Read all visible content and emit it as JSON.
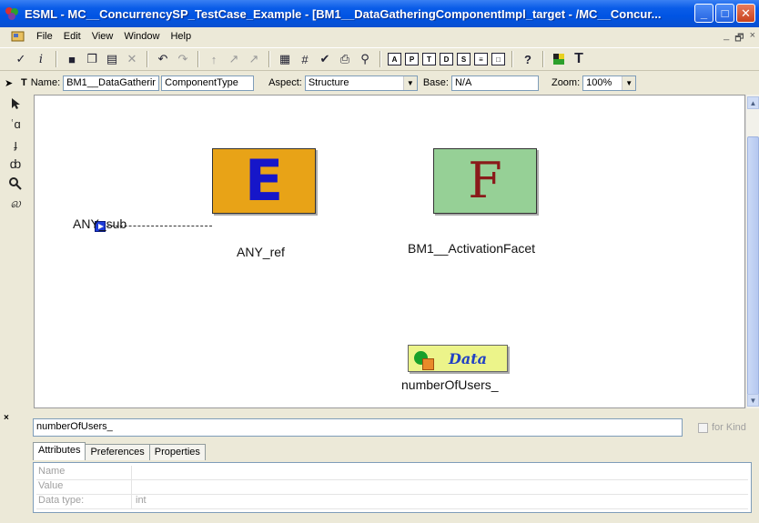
{
  "window": {
    "title": "ESML - MC__ConcurrencySP_TestCase_Example - [BM1__DataGatheringComponentImpl_target - /MC__Concur...",
    "minimize_glyph": "_",
    "maximize_glyph": "□",
    "close_glyph": "✕"
  },
  "menu": {
    "items": [
      "File",
      "Edit",
      "View",
      "Window",
      "Help"
    ],
    "mdi_minimize": "_",
    "mdi_restore": "🗗",
    "mdi_close": "×"
  },
  "toolbar": {
    "buttons": [
      {
        "icon": "check-icon",
        "glyph": "✓"
      },
      {
        "icon": "italic-i-icon",
        "glyph": "i"
      },
      {
        "icon": "save-icon",
        "glyph": "■"
      },
      {
        "icon": "copy-icon",
        "glyph": "❐"
      },
      {
        "icon": "paste-icon",
        "glyph": "▤"
      },
      {
        "icon": "delete-icon",
        "glyph": "✕"
      },
      {
        "icon": "undo-icon",
        "glyph": "↶"
      },
      {
        "icon": "redo-icon",
        "glyph": "↷"
      },
      {
        "icon": "arrow-up-icon",
        "glyph": "↑"
      },
      {
        "icon": "arrow-up-right-icon",
        "glyph": "↗"
      },
      {
        "icon": "arrow-up-right-2-icon",
        "glyph": "↗"
      },
      {
        "icon": "grid-icon",
        "glyph": "▦"
      },
      {
        "icon": "hash-icon",
        "glyph": "#"
      },
      {
        "icon": "verify-icon",
        "glyph": "✔"
      },
      {
        "icon": "print-icon",
        "glyph": "⎙"
      },
      {
        "icon": "binoculars-icon",
        "glyph": "⚲"
      }
    ],
    "box_buttons": [
      "A",
      "P",
      "T",
      "D",
      "S",
      "≡",
      "□"
    ],
    "help_glyph": "?",
    "color_glyph": "▙",
    "text_glyph": "T"
  },
  "namebar": {
    "name_label": "Name:",
    "name_value": "BM1__DataGatherir",
    "type_value": "ComponentType",
    "aspect_label": "Aspect:",
    "aspect_value": "Structure",
    "base_label": "Base:",
    "base_value": "N/A",
    "zoom_label": "Zoom:",
    "zoom_value": "100%"
  },
  "palette": [
    "arrow-pointer-icon",
    "connect-icon",
    "disconnect-icon",
    "set-mode-icon",
    "zoom-icon",
    "visualize-icon"
  ],
  "canvas": {
    "port_label": "ANY_sub",
    "box_e_letter": "E",
    "box_e_label": "ANY_ref",
    "box_f_letter": "F",
    "box_f_label": "BM1__ActivationFacet",
    "data_text": "Data",
    "data_label": "numberOfUsers_"
  },
  "bottom": {
    "close_glyph": "×",
    "object_name": "numberOfUsers_",
    "for_kind_label": "for Kind",
    "tabs": [
      "Attributes",
      "Preferences",
      "Properties"
    ],
    "rows": [
      {
        "key": "Name",
        "value": ""
      },
      {
        "key": "Value",
        "value": ""
      },
      {
        "key": "Data type:",
        "value": "int"
      }
    ]
  }
}
